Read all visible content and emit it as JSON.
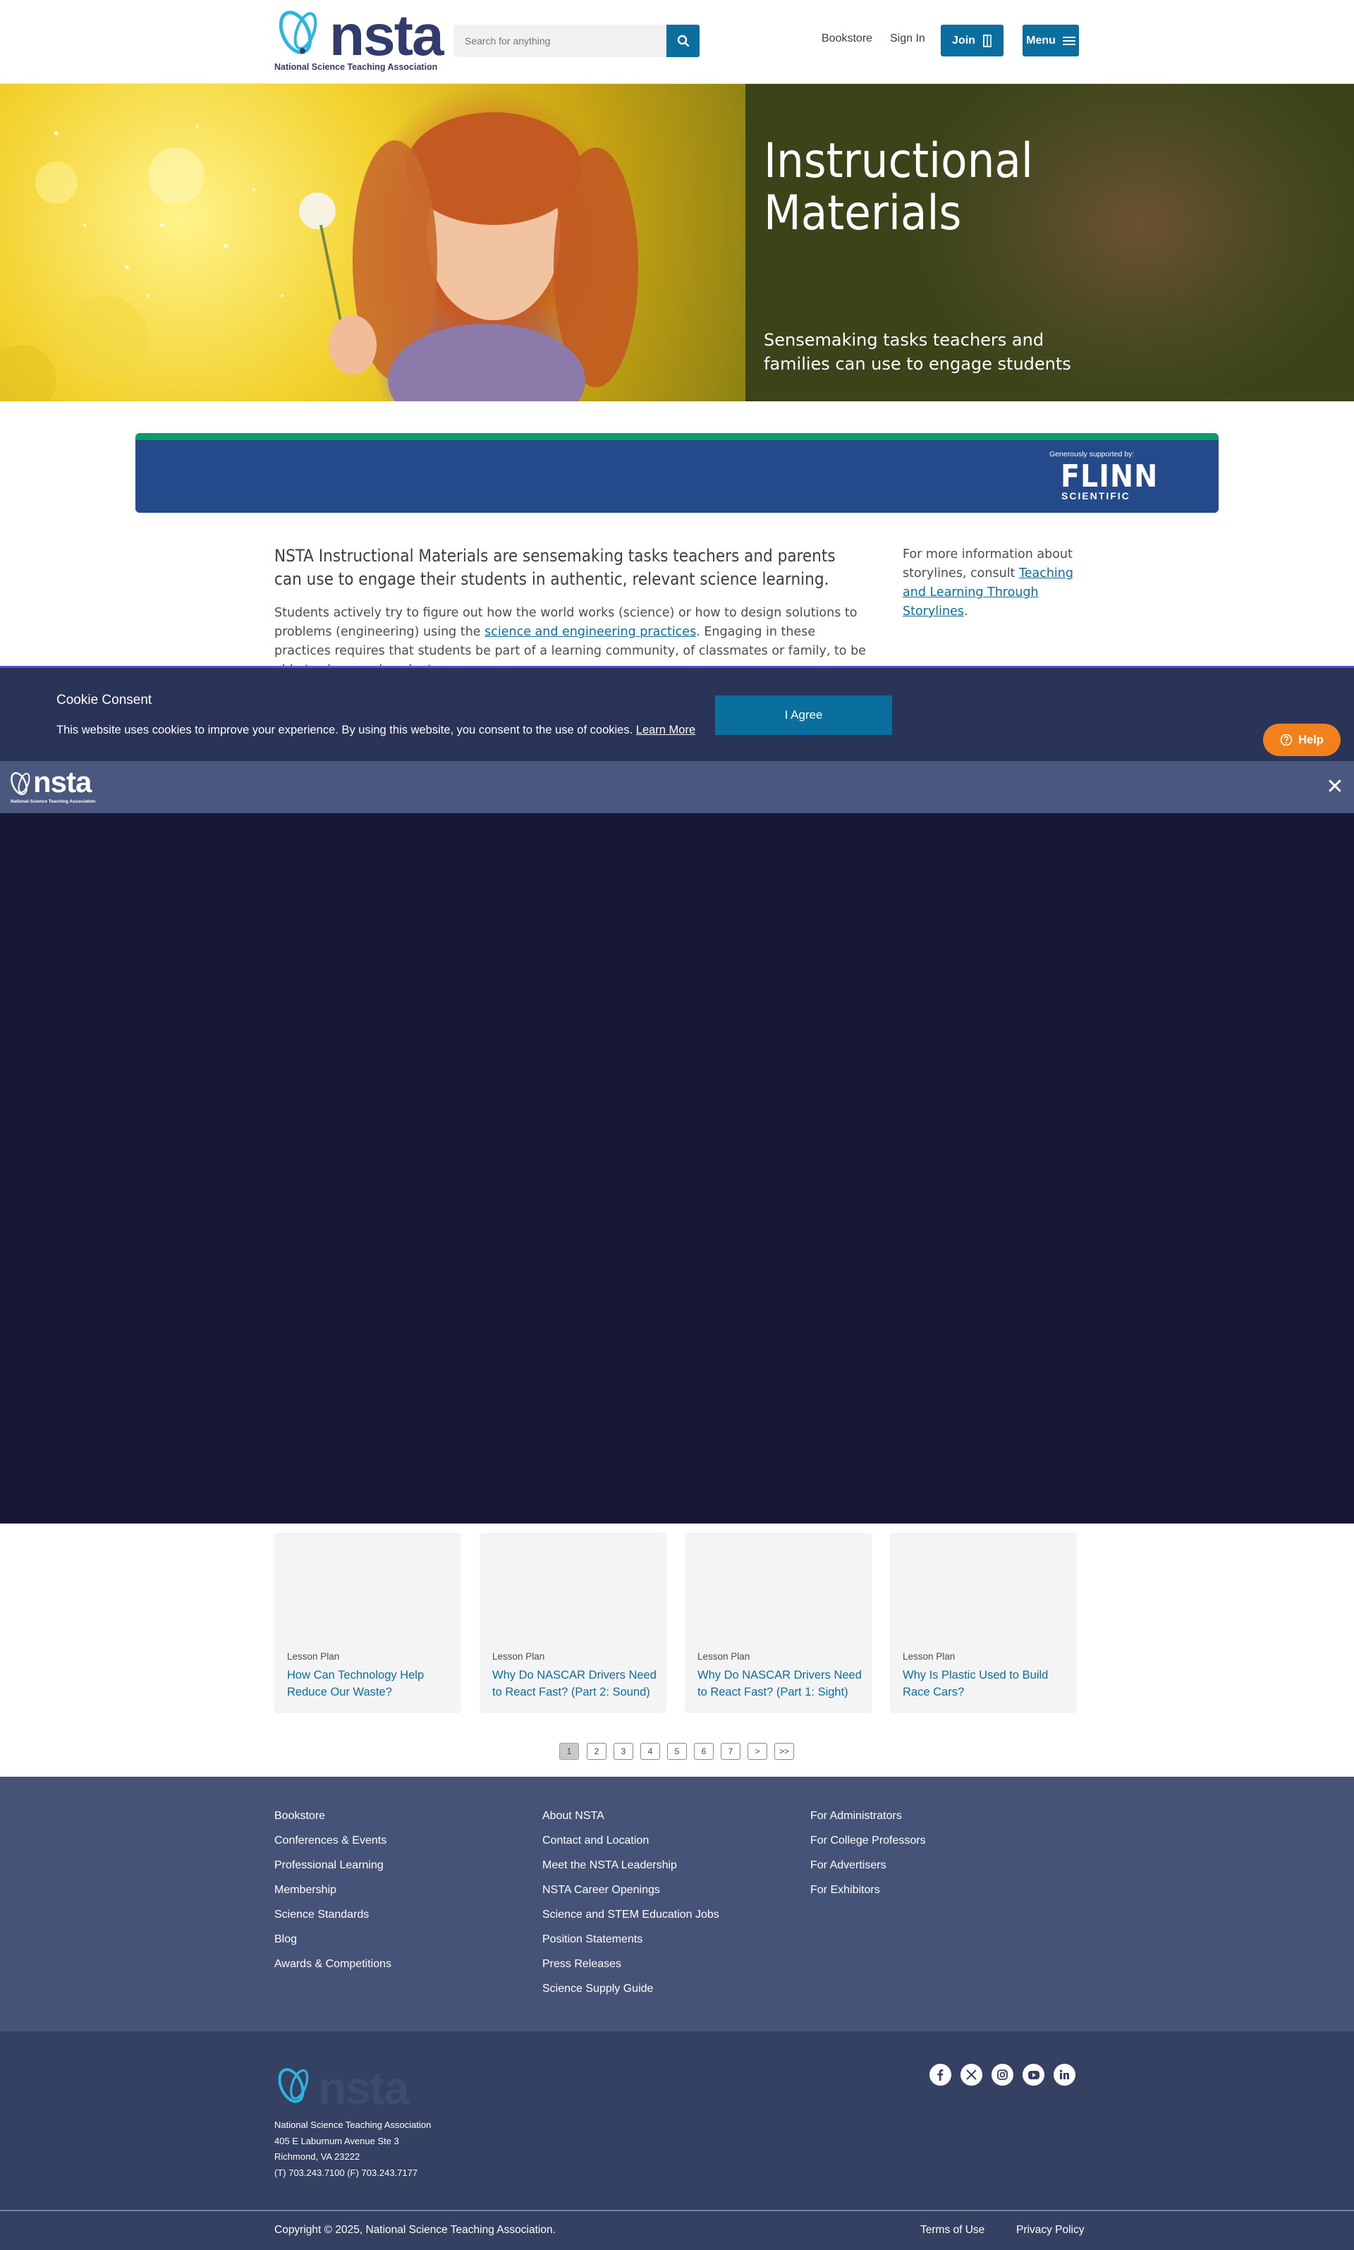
{
  "header": {
    "logo_word": "nsta",
    "logo_tagline": "National Science Teaching Association",
    "search_placeholder": "Search for anything",
    "nav": [
      "Bookstore",
      "Sign In"
    ],
    "join_label": "Join",
    "menu_label": "Menu"
  },
  "hero": {
    "title": "Instructional Materials",
    "subtitle": "Sensemaking tasks teachers and families can use to engage students"
  },
  "sponsor": {
    "label": "Generously supported by:",
    "brand_line1": "FLINN",
    "brand_line2": "SCIENTIFIC"
  },
  "intro": {
    "lead": "NSTA Instructional Materials are sensemaking tasks teachers and parents can use to engage their students in authentic, relevant science learning.",
    "body_pre": "Students actively try to figure out how the world works (science) or how to design solutions to problems (engineering) using the ",
    "body_link": "science and engineering practices",
    "body_post": ". Engaging in these practices requires that students be part of a learning community, of classmates or family, to be able to share and evaluate",
    "side_pre": "For more information about storylines, consult ",
    "side_link": "Teaching and Learning Through Storylines",
    "side_post": "."
  },
  "cookie": {
    "title": "Cookie Consent",
    "text": "This website uses cookies to improve your experience. By using this website, you consent to the use of cookies.",
    "learn_more": "Learn More",
    "agree": "I Agree",
    "help": "Help"
  },
  "cards": [
    {
      "type": "Lesson Plan",
      "title": "How Can Technology Help Reduce Our Waste?"
    },
    {
      "type": "Lesson Plan",
      "title": "Why Do NASCAR Drivers Need to React Fast? (Part 2: Sound)"
    },
    {
      "type": "Lesson Plan",
      "title": "Why Do NASCAR Drivers Need to React Fast? (Part 1: Sight)"
    },
    {
      "type": "Lesson Plan",
      "title": "Why Is Plastic Used to Build Race Cars?"
    }
  ],
  "pagination": {
    "pages": [
      "1",
      "2",
      "3",
      "4",
      "5",
      "6",
      "7"
    ],
    "current": "1",
    "next": ">",
    "last": ">>"
  },
  "footer": {
    "col1": [
      "Bookstore",
      "Conferences & Events",
      "Professional Learning",
      "Membership",
      "Science Standards",
      "Blog",
      "Awards & Competitions"
    ],
    "col2": [
      "About NSTA",
      "Contact and Location",
      "Meet the NSTA Leadership",
      "NSTA Career Openings",
      "Science and STEM Education Jobs",
      "Position Statements",
      "Press Releases",
      "Science Supply Guide"
    ],
    "col3": [
      "For Administrators",
      "For College Professors",
      "For Advertisers",
      "For Exhibitors"
    ],
    "address": [
      "National Science Teaching Association",
      "405 E Laburnum Avenue Ste 3",
      "Richmond, VA 23222",
      "(T) 703.243.7100 (F) 703.243.7177"
    ],
    "social": [
      "facebook-icon",
      "x-icon",
      "instagram-icon",
      "youtube-icon",
      "linkedin-icon"
    ],
    "copyright": "Copyright © 2025, National Science Teaching Association.",
    "terms": "Terms of Use",
    "privacy": "Privacy Policy"
  },
  "colors": {
    "brand_blue": "#0a6e9f",
    "navy": "#323b6b",
    "help_orange": "#f0811c",
    "sponsor_blue": "#244a8b",
    "sponsor_green": "#0f9a6c"
  }
}
